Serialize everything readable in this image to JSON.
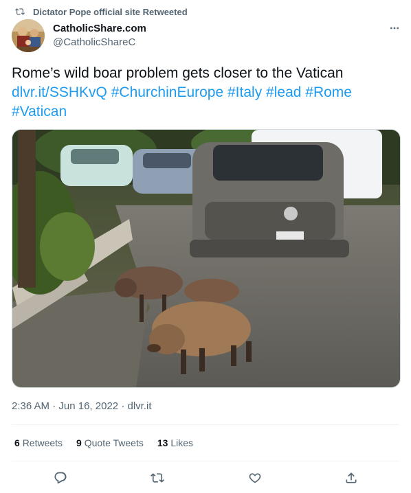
{
  "retweet_banner": {
    "label": "Dictator Pope official site Retweeted",
    "icon": "retweet-icon"
  },
  "author": {
    "name": "CatholicShare.com",
    "handle": "@CatholicShareC",
    "avatar": "avatar-painting"
  },
  "more_icon": "more-horizontal-icon",
  "tweet": {
    "text_line1": "Rome’s wild boar problem gets closer to the Vatican",
    "link": "dlvr.it/SSHKvQ",
    "hashtags": [
      "#ChurchinEurope",
      "#Italy",
      "#lead",
      "#Rome",
      "#Vatican"
    ]
  },
  "photo": {
    "icon": "photo-wild-boars-street"
  },
  "meta": {
    "time": "2:36 AM",
    "separator": "·",
    "date": "Jun 16, 2022",
    "source": "dlvr.it"
  },
  "stats": {
    "retweets_count": "6",
    "retweets_label": "Retweets",
    "quotes_count": "9",
    "quotes_label": "Quote Tweets",
    "likes_count": "13",
    "likes_label": "Likes"
  },
  "actions": [
    "reply-icon",
    "retweet-icon",
    "like-icon",
    "share-icon"
  ],
  "colors": {
    "link": "#1d9bf0",
    "secondary_text": "#536471",
    "primary_text": "#0f1419",
    "divider": "#eff3f4"
  }
}
